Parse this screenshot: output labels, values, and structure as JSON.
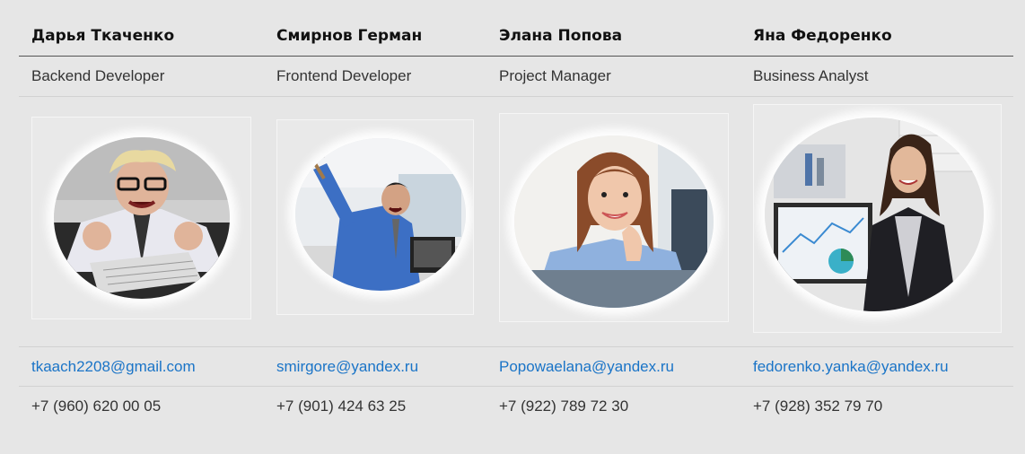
{
  "employees": [
    {
      "name": "Дарья Ткаченко",
      "role": "Backend Developer",
      "photo_icon": "angry-programmer-photo",
      "email": "tkaach2208@gmail.com",
      "phone": "+7 (960) 620 00 05"
    },
    {
      "name": "Смирнов Герман",
      "role": "Frontend Developer",
      "photo_icon": "frustrated-office-worker-photo",
      "email": "smirgore@yandex.ru",
      "phone": "+7 (901) 424 63 25"
    },
    {
      "name": "Элана Попова",
      "role": "Project Manager",
      "photo_icon": "smiling-woman-photo",
      "email": "Popowaelana@yandex.ru",
      "phone": "+7 (922) 789 72 30"
    },
    {
      "name": "Яна Федоренко",
      "role": "Business Analyst",
      "photo_icon": "businesswoman-photo",
      "email": "fedorenko.yanka@yandex.ru",
      "phone": "+7 (928) 352 79 70"
    }
  ],
  "colors": {
    "background": "#e6e6e6",
    "link": "#1a74c7",
    "header_rule": "#555555",
    "row_rule": "#d2d2d2"
  }
}
